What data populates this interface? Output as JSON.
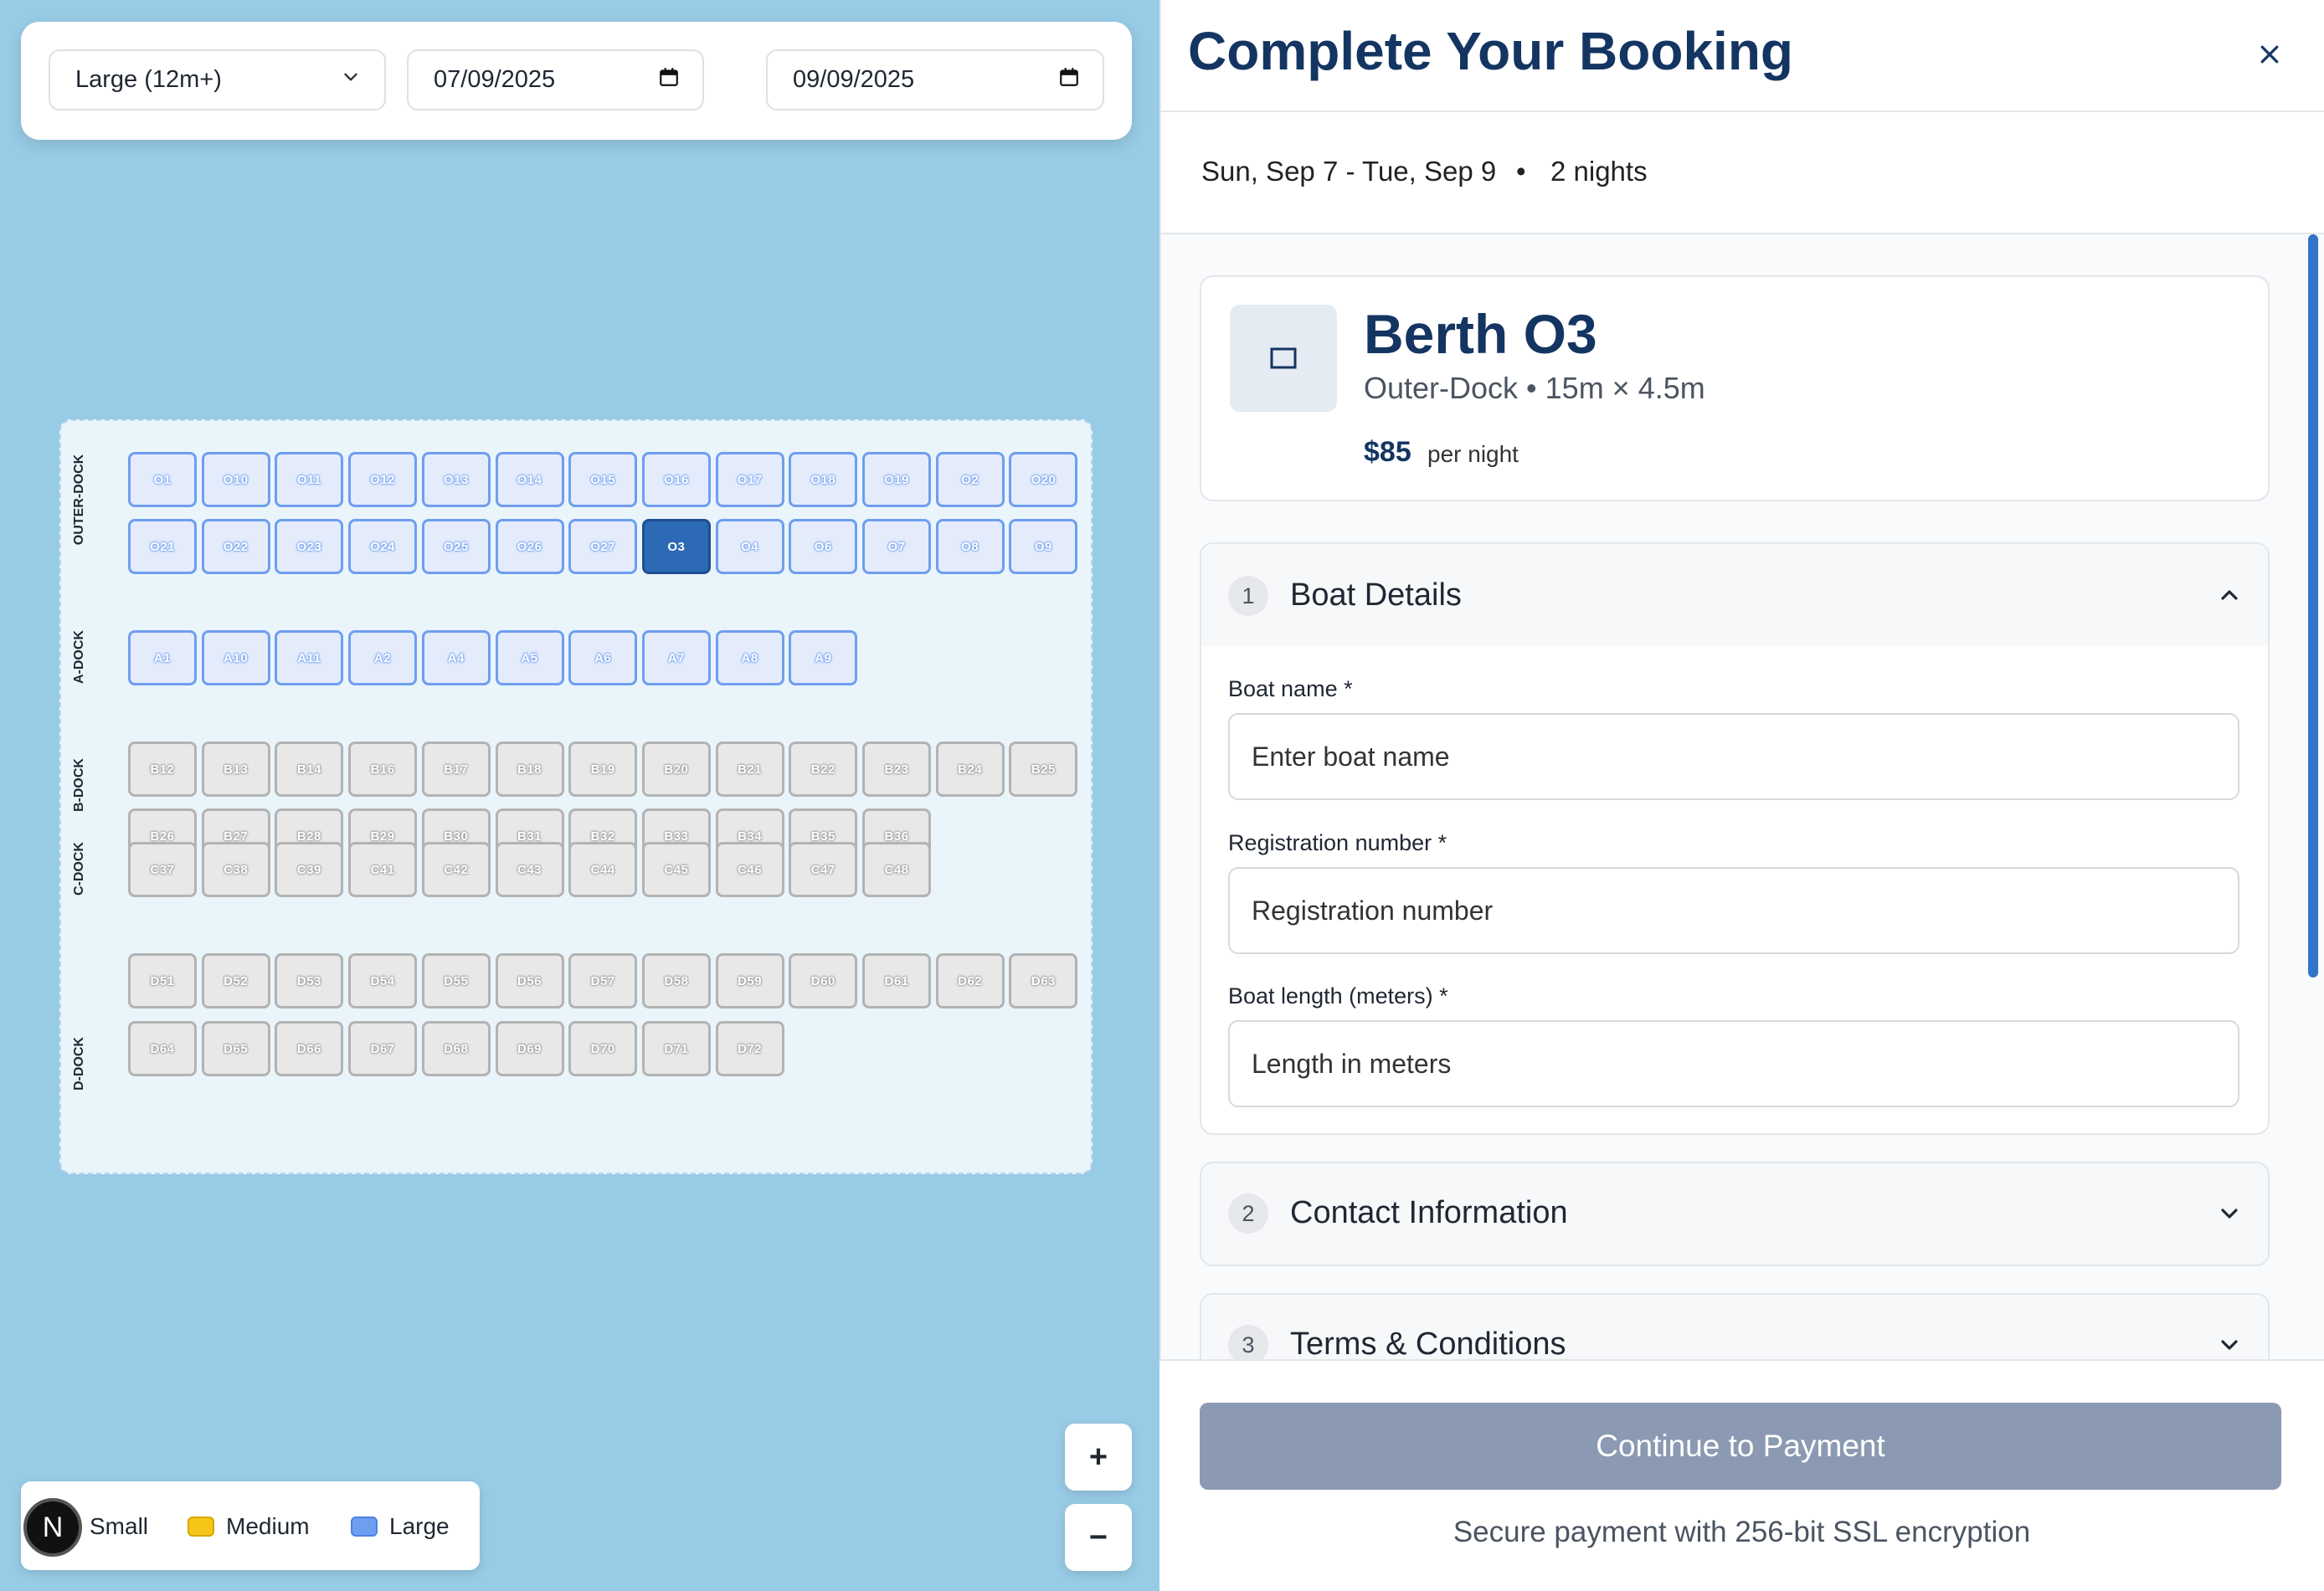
{
  "filters": {
    "size_value": "Large (12m+)",
    "date_from": "07/09/2025",
    "date_to": "09/09/2025"
  },
  "docks": [
    {
      "label": "OUTER-DOCK",
      "type": "large",
      "rows": [
        [
          "O1",
          "O10",
          "O11",
          "O12",
          "O13",
          "O14",
          "O15",
          "O16",
          "O17",
          "O18",
          "O19",
          "O2",
          "O20"
        ],
        [
          "O21",
          "O22",
          "O23",
          "O24",
          "O25",
          "O26",
          "O27",
          "O3",
          "O4",
          "O6",
          "O7",
          "O8",
          "O9"
        ]
      ]
    },
    {
      "label": "A-DOCK",
      "type": "large",
      "rows": [
        [
          "A1",
          "A10",
          "A11",
          "A2",
          "A4",
          "A5",
          "A6",
          "A7",
          "A8",
          "A9"
        ]
      ]
    },
    {
      "label": "B-DOCK",
      "type": "gray",
      "rows": [
        [
          "B12",
          "B13",
          "B14",
          "B16",
          "B17",
          "B18",
          "B19",
          "B20",
          "B21",
          "B22",
          "B23",
          "B24",
          "B25"
        ],
        [
          "B26",
          "B27",
          "B28",
          "B29",
          "B30",
          "B31",
          "B32",
          "B33",
          "B34",
          "B35",
          "B36"
        ]
      ]
    },
    {
      "label": "C-DOCK",
      "type": "gray",
      "rows": [
        [
          "C37",
          "C38",
          "C39",
          "C41",
          "C42",
          "C43",
          "C44",
          "C45",
          "C46",
          "C47",
          "C48"
        ]
      ]
    },
    {
      "label": "D-DOCK",
      "type": "gray",
      "rows": [
        [
          "D51",
          "D52",
          "D53",
          "D54",
          "D55",
          "D56",
          "D57",
          "D58",
          "D59",
          "D60",
          "D61",
          "D62",
          "D63"
        ],
        [
          "D64",
          "D65",
          "D66",
          "D67",
          "D68",
          "D69",
          "D70",
          "D71",
          "D72"
        ]
      ]
    }
  ],
  "selected_berth": "O3",
  "zoom": {
    "in": "+",
    "out": "−"
  },
  "legend": {
    "avatar": "N",
    "items": [
      {
        "label": "Small",
        "color": "#4caf50"
      },
      {
        "label": "Medium",
        "color": "#f5c518"
      },
      {
        "label": "Large",
        "color": "#6f9ef0"
      }
    ]
  },
  "panel": {
    "title": "Complete Your Booking",
    "close_icon": "close-icon",
    "date_range": "Sun, Sep 7 - Tue, Sep 9",
    "separator": "•",
    "nights": "2 nights"
  },
  "berth_card": {
    "name": "Berth O3",
    "details": "Outer-Dock • 15m × 4.5m",
    "price": "$85",
    "price_unit": "per night"
  },
  "sections": [
    {
      "num": "1",
      "title": "Boat Details",
      "expanded": true
    },
    {
      "num": "2",
      "title": "Contact Information",
      "expanded": false
    },
    {
      "num": "3",
      "title": "Terms & Conditions",
      "expanded": false
    }
  ],
  "boat_form": {
    "name_label": "Boat name *",
    "name_placeholder": "Enter boat name",
    "reg_label": "Registration number *",
    "reg_placeholder": "Registration number",
    "length_label": "Boat length (meters) *",
    "length_placeholder": "Length in meters"
  },
  "footer": {
    "pay_button": "Continue to Payment",
    "secure_note": "Secure payment with 256-bit SSL encryption"
  },
  "colors": {
    "brand_navy": "#143562",
    "selected_berth": "#2d6ab5",
    "large_border": "#6f9ef0",
    "accent_scroll": "#3274c8"
  }
}
